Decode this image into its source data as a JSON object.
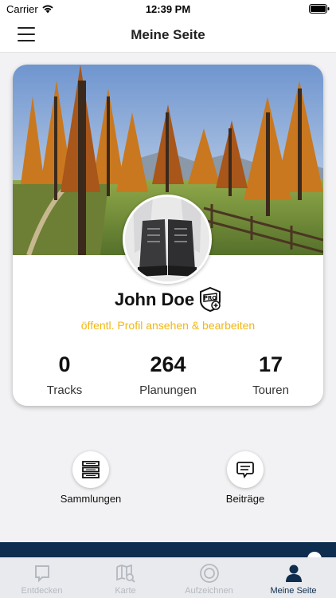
{
  "status_bar": {
    "carrier": "Carrier",
    "time": "12:39 PM"
  },
  "header": {
    "title": "Meine Seite"
  },
  "profile": {
    "name": "John Doe",
    "link_text": "öffentl. Profil ansehen & bearbeiten",
    "stats": [
      {
        "value": "0",
        "label": "Tracks"
      },
      {
        "value": "264",
        "label": "Planungen"
      },
      {
        "value": "17",
        "label": "Touren"
      }
    ]
  },
  "actions": [
    {
      "label": "Sammlungen",
      "icon": "collection-stack-icon"
    },
    {
      "label": "Beiträge",
      "icon": "speech-bubble-icon"
    }
  ],
  "tabs": [
    {
      "label": "Entdecken",
      "icon": "discover-icon",
      "active": false
    },
    {
      "label": "Karte",
      "icon": "map-search-icon",
      "active": false
    },
    {
      "label": "Aufzeichnen",
      "icon": "record-icon",
      "active": false
    },
    {
      "label": "Meine Seite",
      "icon": "person-icon",
      "active": true
    }
  ],
  "colors": {
    "accent": "#f1b713",
    "navy": "#0f2d4f",
    "tab_inactive": "#b5b9bf"
  }
}
